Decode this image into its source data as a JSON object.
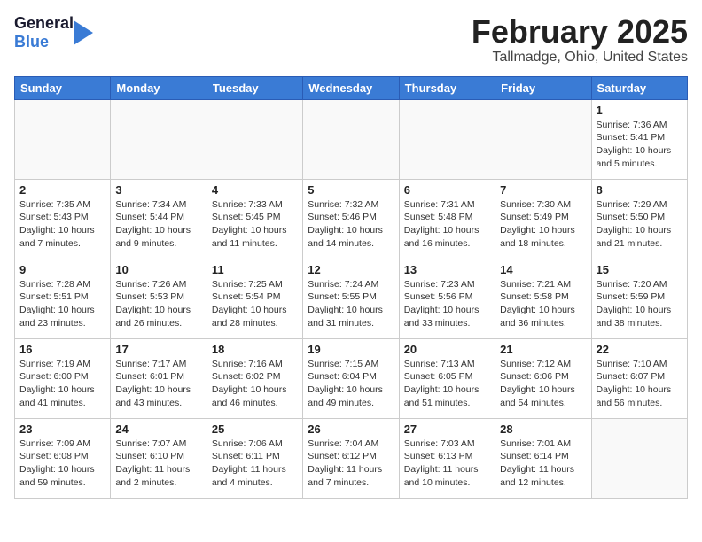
{
  "header": {
    "logo_general": "General",
    "logo_blue": "Blue",
    "title": "February 2025",
    "subtitle": "Tallmadge, Ohio, United States"
  },
  "weekdays": [
    "Sunday",
    "Monday",
    "Tuesday",
    "Wednesday",
    "Thursday",
    "Friday",
    "Saturday"
  ],
  "weeks": [
    [
      {
        "day": "",
        "info": ""
      },
      {
        "day": "",
        "info": ""
      },
      {
        "day": "",
        "info": ""
      },
      {
        "day": "",
        "info": ""
      },
      {
        "day": "",
        "info": ""
      },
      {
        "day": "",
        "info": ""
      },
      {
        "day": "1",
        "info": "Sunrise: 7:36 AM\nSunset: 5:41 PM\nDaylight: 10 hours\nand 5 minutes."
      }
    ],
    [
      {
        "day": "2",
        "info": "Sunrise: 7:35 AM\nSunset: 5:43 PM\nDaylight: 10 hours\nand 7 minutes."
      },
      {
        "day": "3",
        "info": "Sunrise: 7:34 AM\nSunset: 5:44 PM\nDaylight: 10 hours\nand 9 minutes."
      },
      {
        "day": "4",
        "info": "Sunrise: 7:33 AM\nSunset: 5:45 PM\nDaylight: 10 hours\nand 11 minutes."
      },
      {
        "day": "5",
        "info": "Sunrise: 7:32 AM\nSunset: 5:46 PM\nDaylight: 10 hours\nand 14 minutes."
      },
      {
        "day": "6",
        "info": "Sunrise: 7:31 AM\nSunset: 5:48 PM\nDaylight: 10 hours\nand 16 minutes."
      },
      {
        "day": "7",
        "info": "Sunrise: 7:30 AM\nSunset: 5:49 PM\nDaylight: 10 hours\nand 18 minutes."
      },
      {
        "day": "8",
        "info": "Sunrise: 7:29 AM\nSunset: 5:50 PM\nDaylight: 10 hours\nand 21 minutes."
      }
    ],
    [
      {
        "day": "9",
        "info": "Sunrise: 7:28 AM\nSunset: 5:51 PM\nDaylight: 10 hours\nand 23 minutes."
      },
      {
        "day": "10",
        "info": "Sunrise: 7:26 AM\nSunset: 5:53 PM\nDaylight: 10 hours\nand 26 minutes."
      },
      {
        "day": "11",
        "info": "Sunrise: 7:25 AM\nSunset: 5:54 PM\nDaylight: 10 hours\nand 28 minutes."
      },
      {
        "day": "12",
        "info": "Sunrise: 7:24 AM\nSunset: 5:55 PM\nDaylight: 10 hours\nand 31 minutes."
      },
      {
        "day": "13",
        "info": "Sunrise: 7:23 AM\nSunset: 5:56 PM\nDaylight: 10 hours\nand 33 minutes."
      },
      {
        "day": "14",
        "info": "Sunrise: 7:21 AM\nSunset: 5:58 PM\nDaylight: 10 hours\nand 36 minutes."
      },
      {
        "day": "15",
        "info": "Sunrise: 7:20 AM\nSunset: 5:59 PM\nDaylight: 10 hours\nand 38 minutes."
      }
    ],
    [
      {
        "day": "16",
        "info": "Sunrise: 7:19 AM\nSunset: 6:00 PM\nDaylight: 10 hours\nand 41 minutes."
      },
      {
        "day": "17",
        "info": "Sunrise: 7:17 AM\nSunset: 6:01 PM\nDaylight: 10 hours\nand 43 minutes."
      },
      {
        "day": "18",
        "info": "Sunrise: 7:16 AM\nSunset: 6:02 PM\nDaylight: 10 hours\nand 46 minutes."
      },
      {
        "day": "19",
        "info": "Sunrise: 7:15 AM\nSunset: 6:04 PM\nDaylight: 10 hours\nand 49 minutes."
      },
      {
        "day": "20",
        "info": "Sunrise: 7:13 AM\nSunset: 6:05 PM\nDaylight: 10 hours\nand 51 minutes."
      },
      {
        "day": "21",
        "info": "Sunrise: 7:12 AM\nSunset: 6:06 PM\nDaylight: 10 hours\nand 54 minutes."
      },
      {
        "day": "22",
        "info": "Sunrise: 7:10 AM\nSunset: 6:07 PM\nDaylight: 10 hours\nand 56 minutes."
      }
    ],
    [
      {
        "day": "23",
        "info": "Sunrise: 7:09 AM\nSunset: 6:08 PM\nDaylight: 10 hours\nand 59 minutes."
      },
      {
        "day": "24",
        "info": "Sunrise: 7:07 AM\nSunset: 6:10 PM\nDaylight: 11 hours\nand 2 minutes."
      },
      {
        "day": "25",
        "info": "Sunrise: 7:06 AM\nSunset: 6:11 PM\nDaylight: 11 hours\nand 4 minutes."
      },
      {
        "day": "26",
        "info": "Sunrise: 7:04 AM\nSunset: 6:12 PM\nDaylight: 11 hours\nand 7 minutes."
      },
      {
        "day": "27",
        "info": "Sunrise: 7:03 AM\nSunset: 6:13 PM\nDaylight: 11 hours\nand 10 minutes."
      },
      {
        "day": "28",
        "info": "Sunrise: 7:01 AM\nSunset: 6:14 PM\nDaylight: 11 hours\nand 12 minutes."
      },
      {
        "day": "",
        "info": ""
      }
    ]
  ]
}
